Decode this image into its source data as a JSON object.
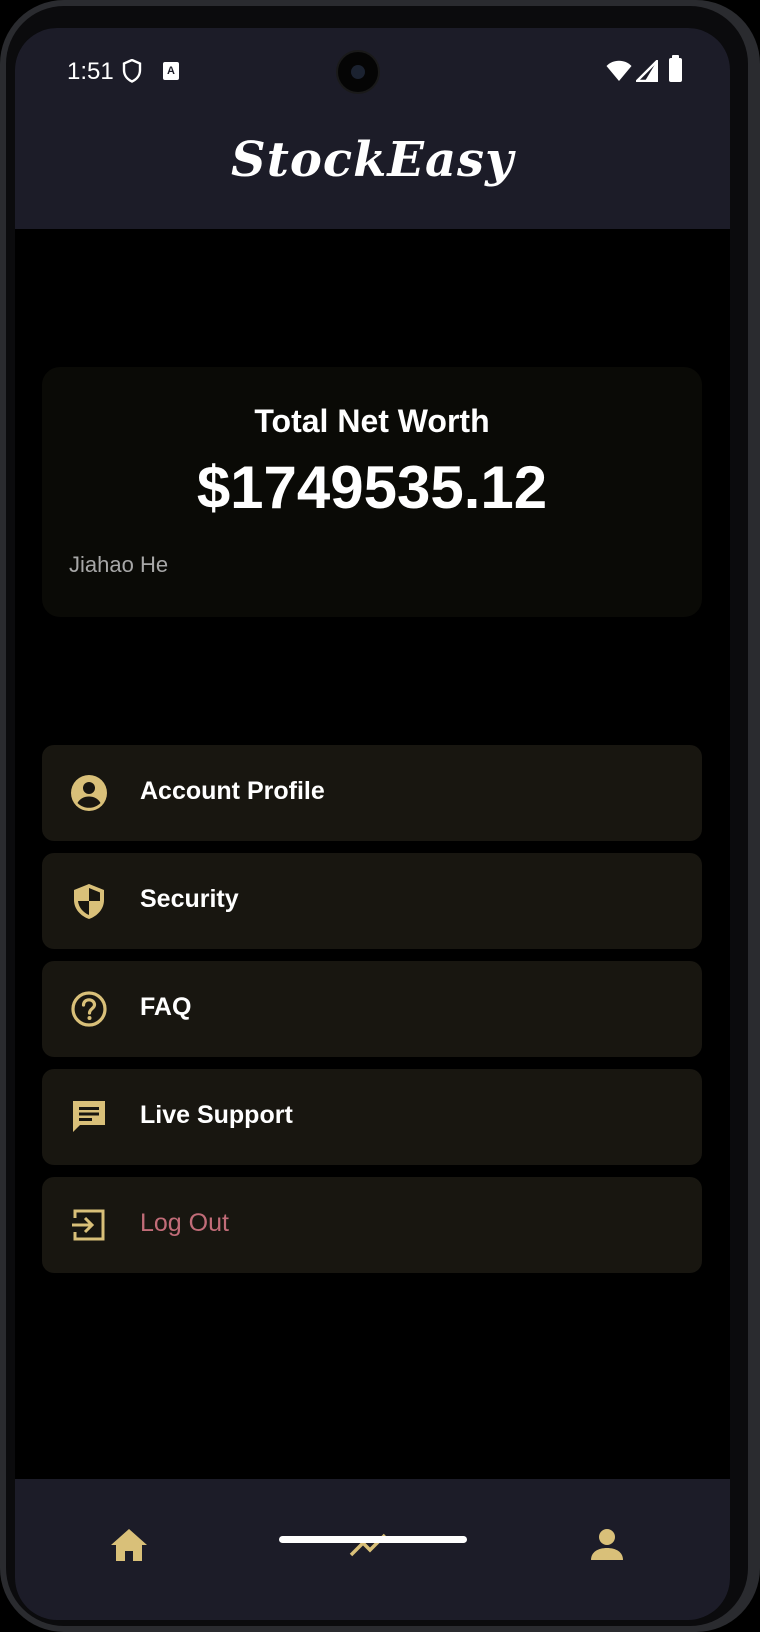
{
  "status_bar": {
    "time": "1:51",
    "notification_badge": "A"
  },
  "header": {
    "app_title": "StockEasy"
  },
  "net_worth_card": {
    "label": "Total Net Worth",
    "value": "$1749535.12",
    "user_name": "Jiahao He"
  },
  "menu": {
    "items": [
      {
        "label": "Account Profile",
        "icon": "account-circle-icon"
      },
      {
        "label": "Security",
        "icon": "shield-icon"
      },
      {
        "label": "FAQ",
        "icon": "help-circle-icon"
      },
      {
        "label": "Live Support",
        "icon": "chat-icon"
      },
      {
        "label": "Log Out",
        "icon": "logout-icon"
      }
    ]
  },
  "bottom_nav": {
    "items": [
      {
        "icon": "home-icon"
      },
      {
        "icon": "trending-icon"
      },
      {
        "icon": "person-icon"
      }
    ]
  },
  "colors": {
    "accent_gold": "#d9c079",
    "header_bg": "#1c1c28",
    "card_bg": "#0a0a06",
    "menu_bg": "#181610",
    "logout_text": "#c16c78"
  }
}
